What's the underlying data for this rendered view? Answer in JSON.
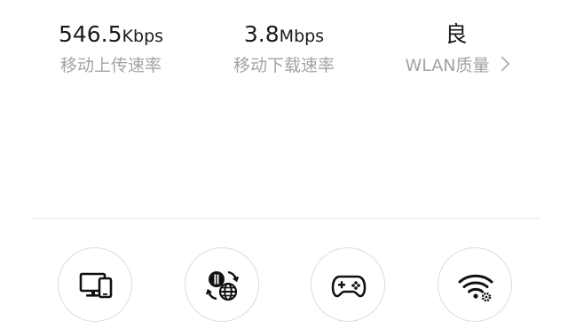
{
  "stats": [
    {
      "value": "546.5",
      "unit": "Kbps",
      "label": "移动上传速率"
    },
    {
      "value": "3.8",
      "unit": "Mbps",
      "label": "移动下载速率"
    },
    {
      "value": "良",
      "unit": "",
      "label": "WLAN质量"
    }
  ],
  "tools": [
    {
      "icon": "devices-icon"
    },
    {
      "icon": "network-switch-icon"
    },
    {
      "icon": "gamepad-icon"
    },
    {
      "icon": "wifi-settings-icon"
    }
  ],
  "colors": {
    "text": "#1a1a1a",
    "label": "#a3a3a3",
    "divider": "#ececec",
    "border": "#dcdcdc"
  }
}
